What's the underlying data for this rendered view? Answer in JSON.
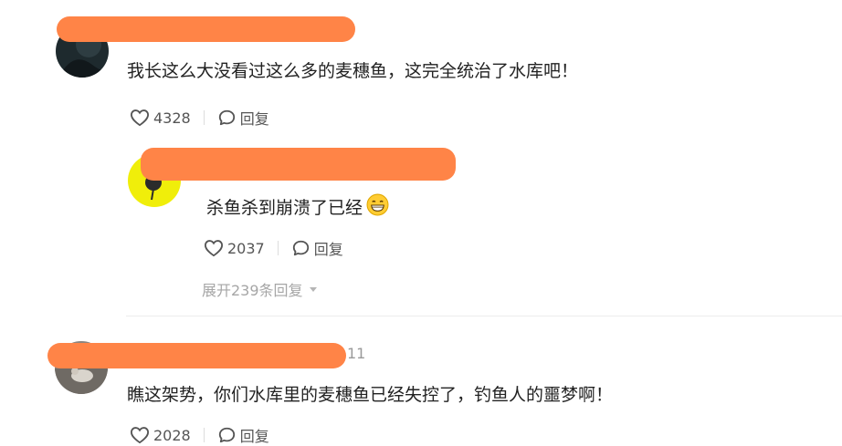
{
  "comments": [
    {
      "username": "",
      "text": "我长这么大没看过这么多的麦穗鱼，这完全统治了水库吧！",
      "likes": "4328",
      "reply_label": "回复"
    },
    {
      "username": "",
      "text": "杀鱼杀到崩溃了已经",
      "emoji": "grinning-face-emoji",
      "likes": "2037",
      "reply_label": "回复",
      "expand_label": "展开239条回复"
    },
    {
      "username": "",
      "time_fragment": "11",
      "text": "瞧这架势，你们水库里的麦穗鱼已经失控了，钓鱼人的噩梦啊！",
      "likes": "2028",
      "reply_label": "回复"
    }
  ],
  "colors": {
    "redaction": "#ff8447",
    "text": "#222222",
    "meta": "#555555",
    "expand": "#a6a6a6"
  }
}
